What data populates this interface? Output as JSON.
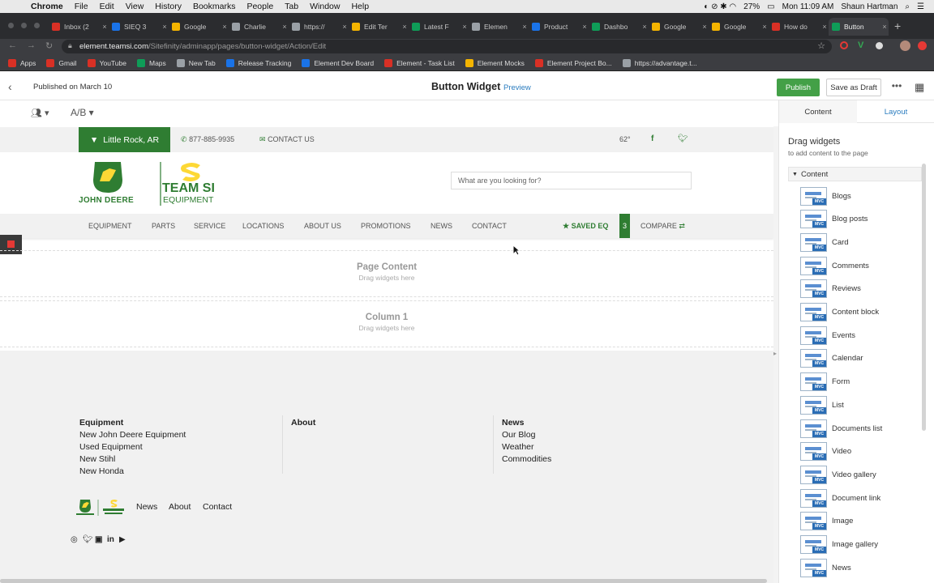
{
  "mac_menu": {
    "app": "Chrome",
    "items": [
      "File",
      "Edit",
      "View",
      "History",
      "Bookmarks",
      "People",
      "Tab",
      "Window",
      "Help"
    ],
    "battery": "27%",
    "clock": "Mon 11:09 AM",
    "user": "Shaun Hartman"
  },
  "tabs": [
    {
      "title": "Inbox (2",
      "color": "#d93025"
    },
    {
      "title": "SIEQ 3",
      "color": "#1a73e8"
    },
    {
      "title": "Google",
      "color": "#f4b400"
    },
    {
      "title": "Charlie",
      "color": "#9aa0a6"
    },
    {
      "title": "https://",
      "color": "#9aa0a6"
    },
    {
      "title": "Edit Ter",
      "color": "#f4b400"
    },
    {
      "title": "Latest F",
      "color": "#0f9d58"
    },
    {
      "title": "Elemen",
      "color": "#9aa0a6"
    },
    {
      "title": "Product",
      "color": "#1a73e8"
    },
    {
      "title": "Dashbo",
      "color": "#0f9d58"
    },
    {
      "title": "Google",
      "color": "#f4b400"
    },
    {
      "title": "Google",
      "color": "#f4b400"
    },
    {
      "title": "How do",
      "color": "#d93025"
    },
    {
      "title": "Button",
      "color": "#0f9d58"
    }
  ],
  "url": {
    "host": "element.teamsi.com",
    "path": "/Sitefinity/adminapp/pages/button-widget/Action/Edit"
  },
  "bookmarks": [
    {
      "label": "Apps",
      "color": "#d93025"
    },
    {
      "label": "Gmail",
      "color": "#d93025"
    },
    {
      "label": "YouTube",
      "color": "#d93025"
    },
    {
      "label": "Maps",
      "color": "#0f9d58"
    },
    {
      "label": "New Tab",
      "color": "#9aa0a6"
    },
    {
      "label": "Release Tracking",
      "color": "#1a73e8"
    },
    {
      "label": "Element Dev Board",
      "color": "#1a73e8"
    },
    {
      "label": "Element - Task List",
      "color": "#d93025"
    },
    {
      "label": "Element Mocks",
      "color": "#f4b400"
    },
    {
      "label": "Element Project Bo...",
      "color": "#d93025"
    },
    {
      "label": "https://advantage.t...",
      "color": "#9aa0a6"
    }
  ],
  "cms": {
    "published": "Published on March 10",
    "page_title": "Button Widget",
    "preview": "Preview",
    "publish": "Publish",
    "save_draft": "Save as Draft",
    "ab": "A/B"
  },
  "site": {
    "location": "Little Rock, AR",
    "phone": "877-885-9935",
    "contact_us": "CONTACT US",
    "temperature": "62°",
    "brand_left": "JOHN DEERE",
    "brand_right_top": "TEAM SI",
    "brand_right_bottom": "EQUIPMENT",
    "search_placeholder": "What are you looking for?",
    "nav": [
      "EQUIPMENT",
      "PARTS",
      "SERVICE",
      "LOCATIONS",
      "ABOUT US",
      "PROMOTIONS",
      "NEWS",
      "CONTACT"
    ],
    "saved_eq": "SAVED EQ",
    "saved_count": "3",
    "compare": "COMPARE",
    "zone1_title": "Page Content",
    "zone1_sub": "Drag widgets here",
    "zone2_title": "Column 1",
    "zone2_sub": "Drag widgets here",
    "footer": {
      "col1_title": "Equipment",
      "col1_links": [
        "New John Deere Equipment",
        "Used Equipment",
        "New Stihl",
        "New Honda"
      ],
      "col2_title": "About",
      "col3_title": "News",
      "col3_links": [
        "Our Blog",
        "Weather",
        "Commodities"
      ],
      "nav": [
        "News",
        "About",
        "Contact"
      ]
    }
  },
  "panel": {
    "tab_content": "Content",
    "tab_layout": "Layout",
    "drag_title": "Drag widgets",
    "drag_sub": "to add content to the page",
    "section": "Content",
    "widgets": [
      "Blogs",
      "Blog posts",
      "Card",
      "Comments",
      "Reviews",
      "Content block",
      "Events",
      "Calendar",
      "Form",
      "List",
      "Documents list",
      "Video",
      "Video gallery",
      "Document link",
      "Image",
      "Image gallery",
      "News"
    ]
  }
}
